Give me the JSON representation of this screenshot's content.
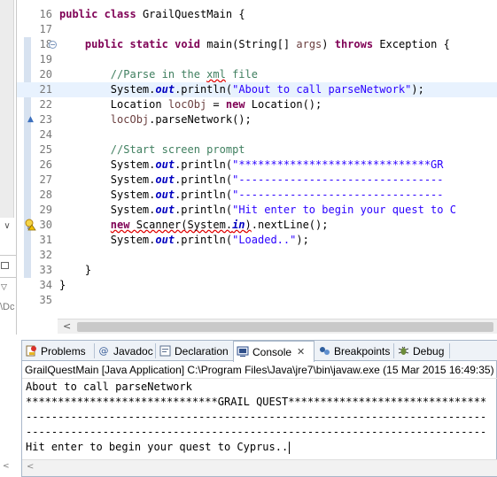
{
  "editor": {
    "lines": [
      {
        "num": "16",
        "tokens": [
          {
            "t": "public",
            "c": "kw"
          },
          {
            "t": " "
          },
          {
            "t": "class",
            "c": "kw"
          },
          {
            "t": " GrailQuestMain {"
          }
        ]
      },
      {
        "num": "17",
        "tokens": []
      },
      {
        "num": "18",
        "tokens": [
          {
            "t": "    "
          },
          {
            "t": "public",
            "c": "kw"
          },
          {
            "t": " "
          },
          {
            "t": "static",
            "c": "kw"
          },
          {
            "t": " "
          },
          {
            "t": "void",
            "c": "kw"
          },
          {
            "t": " main(String[] "
          },
          {
            "t": "args",
            "c": "var"
          },
          {
            "t": ") "
          },
          {
            "t": "throws",
            "c": "kw"
          },
          {
            "t": " Exception {"
          }
        ],
        "fold": "minus"
      },
      {
        "num": "19",
        "tokens": []
      },
      {
        "num": "20",
        "tokens": [
          {
            "t": "        "
          },
          {
            "t": "//Parse in the ",
            "c": "cmt"
          },
          {
            "t": "xml",
            "c": "cmt sq"
          },
          {
            "t": " file",
            "c": "cmt"
          }
        ]
      },
      {
        "num": "21",
        "tokens": [
          {
            "t": "        System."
          },
          {
            "t": "out",
            "c": "fld"
          },
          {
            "t": ".println("
          },
          {
            "t": "\"About to call parseNetwork\"",
            "c": "str"
          },
          {
            "t": ");"
          }
        ],
        "highlight": true
      },
      {
        "num": "22",
        "tokens": [
          {
            "t": "        Location "
          },
          {
            "t": "locObj",
            "c": "var"
          },
          {
            "t": " = "
          },
          {
            "t": "new",
            "c": "kw"
          },
          {
            "t": " Location();"
          }
        ]
      },
      {
        "num": "23",
        "tokens": [
          {
            "t": "        "
          },
          {
            "t": "locObj",
            "c": "var"
          },
          {
            "t": ".parseNetwork();"
          }
        ],
        "marker": "override"
      },
      {
        "num": "24",
        "tokens": []
      },
      {
        "num": "25",
        "tokens": [
          {
            "t": "        "
          },
          {
            "t": "//Start screen prompt",
            "c": "cmt"
          }
        ]
      },
      {
        "num": "26",
        "tokens": [
          {
            "t": "        System."
          },
          {
            "t": "out",
            "c": "fld"
          },
          {
            "t": ".println("
          },
          {
            "t": "\"******************************GR",
            "c": "str"
          }
        ]
      },
      {
        "num": "27",
        "tokens": [
          {
            "t": "        System."
          },
          {
            "t": "out",
            "c": "fld"
          },
          {
            "t": ".println("
          },
          {
            "t": "\"--------------------------------",
            "c": "str"
          }
        ]
      },
      {
        "num": "28",
        "tokens": [
          {
            "t": "        System."
          },
          {
            "t": "out",
            "c": "fld"
          },
          {
            "t": ".println("
          },
          {
            "t": "\"--------------------------------",
            "c": "str"
          }
        ]
      },
      {
        "num": "29",
        "tokens": [
          {
            "t": "        System."
          },
          {
            "t": "out",
            "c": "fld"
          },
          {
            "t": ".println("
          },
          {
            "t": "\"Hit enter to begin your quest to C",
            "c": "str"
          }
        ]
      },
      {
        "num": "30",
        "tokens": [
          {
            "t": "        "
          },
          {
            "t": "new",
            "c": "kw sq"
          },
          {
            "t": " Scanner(System.",
            "c": "sq"
          },
          {
            "t": "in",
            "c": "fld sq"
          },
          {
            "t": ")",
            "c": "sq"
          },
          {
            "t": ".nextLine();"
          }
        ],
        "marker": "warning"
      },
      {
        "num": "31",
        "tokens": [
          {
            "t": "        System."
          },
          {
            "t": "out",
            "c": "fld"
          },
          {
            "t": ".println("
          },
          {
            "t": "\"Loaded..\"",
            "c": "str"
          },
          {
            "t": ");"
          }
        ]
      },
      {
        "num": "32",
        "tokens": []
      },
      {
        "num": "33",
        "tokens": [
          {
            "t": "    }"
          }
        ]
      },
      {
        "num": "34",
        "tokens": [
          {
            "t": "}"
          }
        ]
      },
      {
        "num": "35",
        "tokens": []
      }
    ]
  },
  "sidebar": {
    "truncated_label": "\\Dc"
  },
  "panel": {
    "tabs": [
      {
        "label": "Problems",
        "icon": "problems-icon"
      },
      {
        "label": "Javadoc",
        "icon": "javadoc-icon"
      },
      {
        "label": "Declaration",
        "icon": "declaration-icon"
      },
      {
        "label": "Console",
        "icon": "console-icon",
        "active": true
      },
      {
        "label": "Breakpoints",
        "icon": "breakpoints-icon"
      },
      {
        "label": "Debug",
        "icon": "debug-icon"
      }
    ],
    "launch_description": "GrailQuestMain [Java Application] C:\\Program Files\\Java\\jre7\\bin\\javaw.exe (15 Mar 2015 16:49:35)",
    "console_lines": [
      "About to call parseNetwork",
      "******************************GRAIL QUEST*******************************",
      "------------------------------------------------------------------------",
      "------------------------------------------------------------------------",
      "Hit enter to begin your quest to Cyprus.."
    ]
  }
}
